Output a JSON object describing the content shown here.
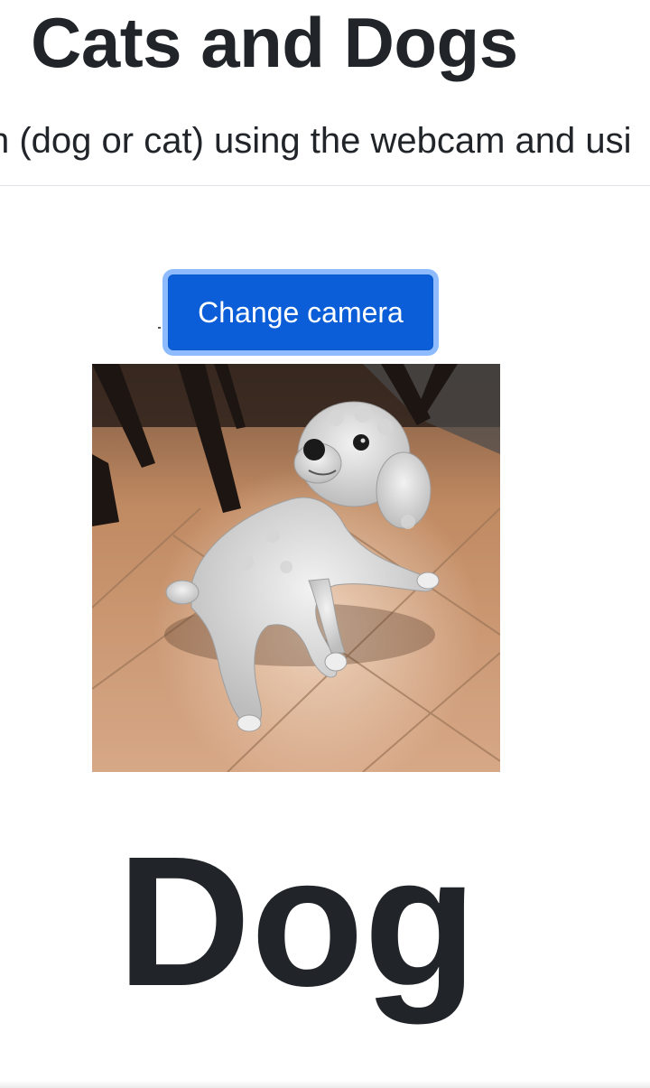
{
  "header": {
    "title": "Cats and Dogs",
    "subtitle": "n (dog or cat) using the webcam and usi"
  },
  "camera": {
    "change_camera_label": "Change camera",
    "feed_subject": "dog"
  },
  "result": {
    "prediction": "Dog"
  },
  "colors": {
    "button_bg": "#0b5ed7",
    "button_focus_ring": "#86b7fe",
    "text": "#212529",
    "divider": "#dee2e6"
  }
}
